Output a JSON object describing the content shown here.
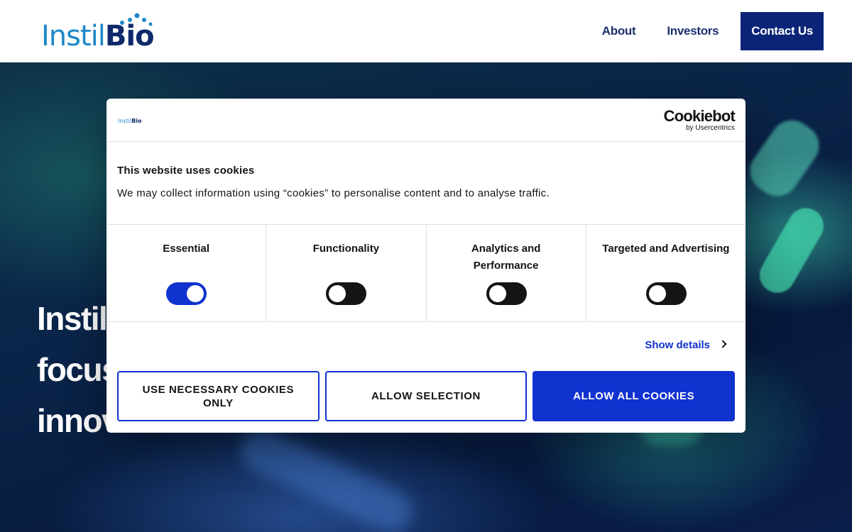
{
  "header": {
    "logo": {
      "part1": "Instil",
      "part2": "Bio"
    },
    "nav": [
      {
        "label": "About"
      },
      {
        "label": "Investors"
      }
    ],
    "contact_label": "Contact Us"
  },
  "hero": {
    "lines": [
      "Instil",
      "focus",
      "innov"
    ]
  },
  "cookie_dialog": {
    "brand": {
      "name": "Cookiebot",
      "sub": "by Usercentrics"
    },
    "title": "This website uses cookies",
    "text": "We may collect information using “cookies” to personalise content and to analyse traffic.",
    "categories": [
      {
        "label": "Essential",
        "enabled": true
      },
      {
        "label": "Functionality",
        "enabled": false
      },
      {
        "label": "Analytics and Performance",
        "enabled": false
      },
      {
        "label": "Targeted and Advertising",
        "enabled": false
      }
    ],
    "show_details": "Show details",
    "buttons": {
      "necessary": "USE NECESSARY COOKIES ONLY",
      "selection": "ALLOW SELECTION",
      "all": "ALLOW ALL COOKIES"
    }
  },
  "colors": {
    "accent": "#1032cf",
    "brand_dark": "#0b2478",
    "brand_light": "#1e88c8"
  }
}
